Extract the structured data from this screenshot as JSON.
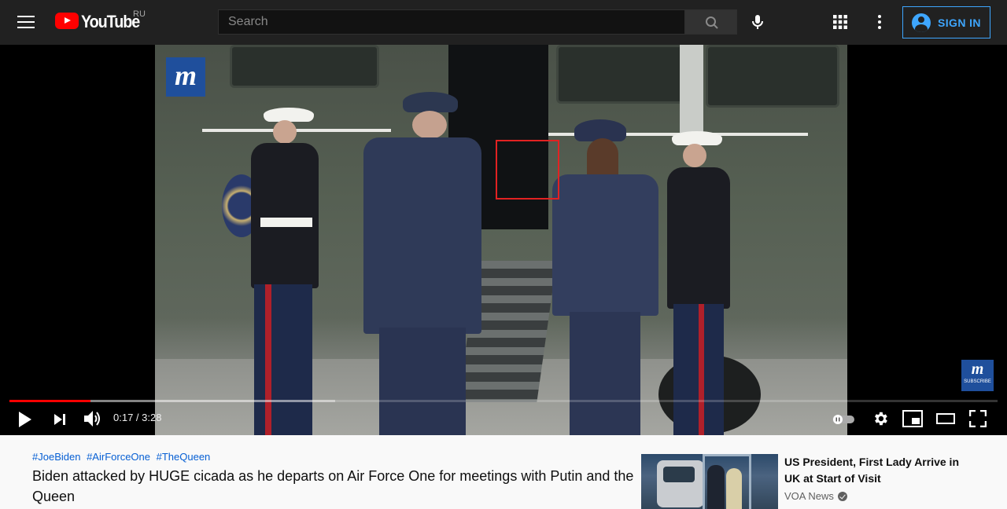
{
  "masthead": {
    "logo_text": "YouTube",
    "country_code": "RU",
    "search_placeholder": "Search",
    "signin_label": "SIGN IN",
    "icons": [
      "hamburger-icon",
      "search-icon",
      "microphone-icon",
      "apps-grid-icon",
      "more-vert-icon",
      "account-icon"
    ]
  },
  "player": {
    "current_time": "0:17",
    "duration": "3:28",
    "time_display": "0:17 / 3:28",
    "progress_fraction": 0.0817,
    "buffered_fraction": 0.33,
    "watermark_letter": "m",
    "subscribe_badge_letter": "m",
    "subscribe_badge_text": "SUBSCRIBE",
    "colors": {
      "progress_played": "#ff0000",
      "highlight_box": "#e22222",
      "brand_badge": "#1f4f9c"
    }
  },
  "video": {
    "hashtags": [
      "#JoeBiden",
      "#AirForceOne",
      "#TheQueen"
    ],
    "title": "Biden attacked by HUGE cicada as he departs on Air Force One for meetings with Putin and the Queen"
  },
  "recommendation": {
    "title": "US President, First Lady Arrive in UK at Start of Visit",
    "channel": "VOA News",
    "verified": true
  },
  "colors": {
    "accent": "#3ea6ff",
    "link": "#065fd4",
    "masthead_bg": "#212121"
  }
}
